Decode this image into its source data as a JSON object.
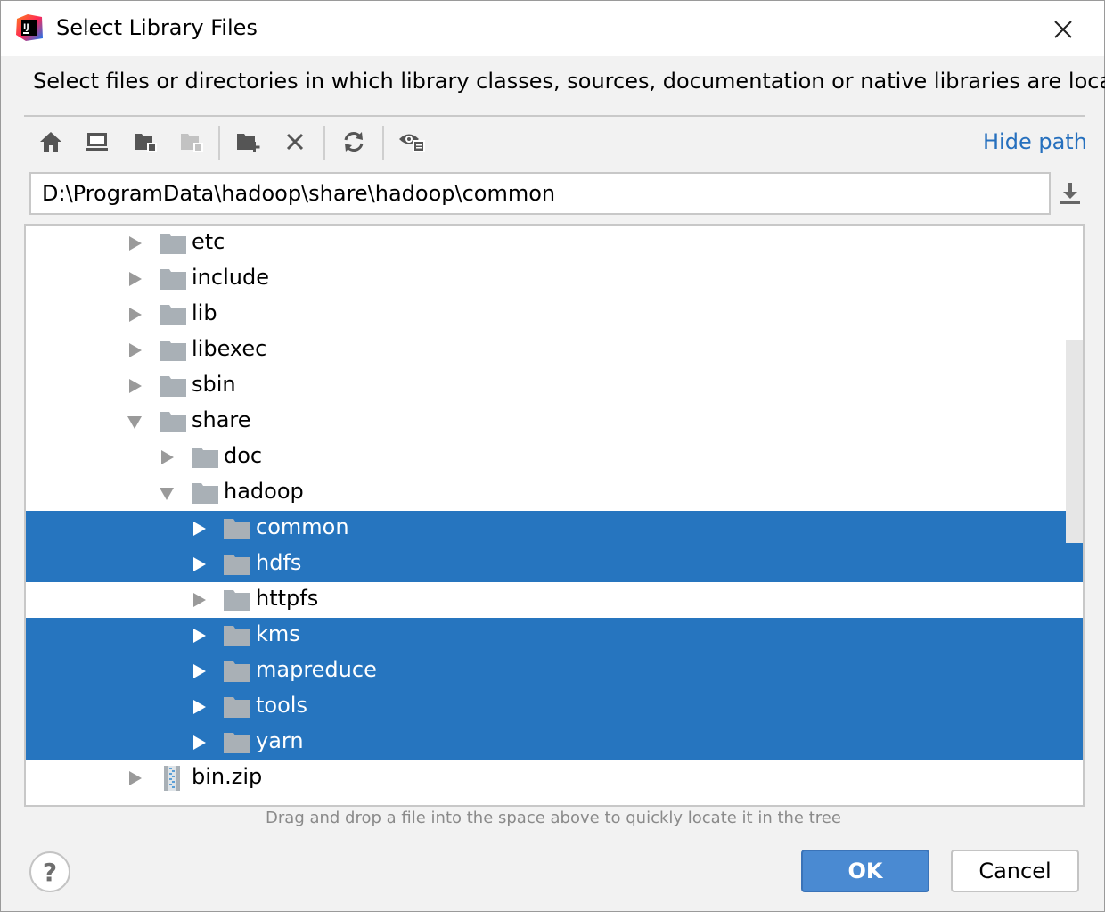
{
  "window": {
    "title": "Select Library Files",
    "description": "Select files or directories in which library classes, sources, documentation or native libraries are located"
  },
  "toolbar": {
    "buttons": [
      "home-icon",
      "desktop-icon",
      "project-folder-icon",
      "module-folder-icon",
      "new-folder-icon",
      "delete-icon",
      "refresh-icon",
      "show-hidden-icon"
    ],
    "hide_path": "Hide path"
  },
  "path": {
    "value": "D:\\ProgramData\\hadoop\\share\\hadoop\\common"
  },
  "tree": {
    "items": [
      {
        "label": "etc",
        "expanded": false,
        "selected": false,
        "type": "folder"
      },
      {
        "label": "include",
        "expanded": false,
        "selected": false,
        "type": "folder"
      },
      {
        "label": "lib",
        "expanded": false,
        "selected": false,
        "type": "folder"
      },
      {
        "label": "libexec",
        "expanded": false,
        "selected": false,
        "type": "folder"
      },
      {
        "label": "sbin",
        "expanded": false,
        "selected": false,
        "type": "folder"
      },
      {
        "label": "share",
        "expanded": true,
        "selected": false,
        "type": "folder"
      },
      {
        "label": "doc",
        "expanded": false,
        "selected": false,
        "type": "folder"
      },
      {
        "label": "hadoop",
        "expanded": true,
        "selected": false,
        "type": "folder"
      },
      {
        "label": "common",
        "expanded": false,
        "selected": true,
        "type": "folder"
      },
      {
        "label": "hdfs",
        "expanded": false,
        "selected": true,
        "type": "folder"
      },
      {
        "label": "httpfs",
        "expanded": false,
        "selected": false,
        "type": "folder"
      },
      {
        "label": "kms",
        "expanded": false,
        "selected": true,
        "type": "folder"
      },
      {
        "label": "mapreduce",
        "expanded": false,
        "selected": true,
        "type": "folder"
      },
      {
        "label": "tools",
        "expanded": false,
        "selected": true,
        "type": "folder"
      },
      {
        "label": "yarn",
        "expanded": false,
        "selected": true,
        "type": "folder"
      },
      {
        "label": "bin.zip",
        "expanded": false,
        "selected": false,
        "type": "zip"
      }
    ]
  },
  "hint": "Drag and drop a file into the space above to quickly locate it in the tree",
  "buttons": {
    "help": "?",
    "ok": "OK",
    "cancel": "Cancel"
  },
  "colors": {
    "selection": "#2675bf",
    "link": "#2670be",
    "ok_button": "#4a8ad2",
    "folder": "#a9b0b6"
  }
}
